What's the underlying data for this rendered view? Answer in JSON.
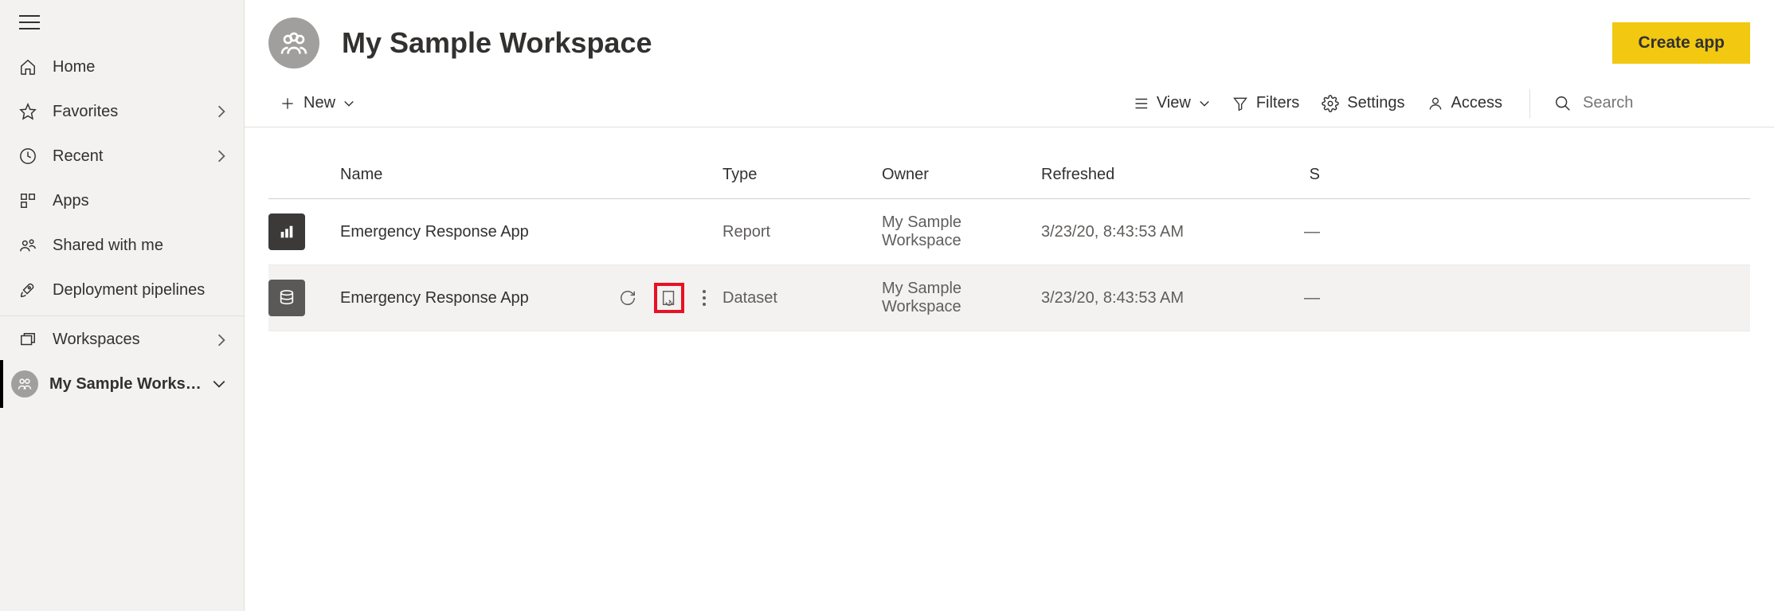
{
  "sidebar": {
    "items": [
      {
        "label": "Home"
      },
      {
        "label": "Favorites",
        "has_chevron": true
      },
      {
        "label": "Recent",
        "has_chevron": true
      },
      {
        "label": "Apps"
      },
      {
        "label": "Shared with me"
      },
      {
        "label": "Deployment pipelines"
      }
    ],
    "workspaces_label": "Workspaces",
    "current_workspace": "My Sample Works…"
  },
  "workspace": {
    "title": "My Sample Workspace",
    "create_app_label": "Create app"
  },
  "toolbar": {
    "new_label": "New",
    "view_label": "View",
    "filters_label": "Filters",
    "settings_label": "Settings",
    "access_label": "Access",
    "search_placeholder": "Search"
  },
  "table": {
    "columns": {
      "name": "Name",
      "type": "Type",
      "owner": "Owner",
      "refreshed": "Refreshed",
      "sensitivity": "S"
    },
    "rows": [
      {
        "icon": "report",
        "name": "Emergency Response App",
        "type": "Report",
        "owner": "My Sample Workspace",
        "refreshed": "3/23/20, 8:43:53 AM",
        "sensitivity": "—",
        "hovered": false
      },
      {
        "icon": "dataset",
        "name": "Emergency Response App",
        "type": "Dataset",
        "owner": "My Sample Workspace",
        "refreshed": "3/23/20, 8:43:53 AM",
        "sensitivity": "—",
        "hovered": true,
        "schedule_highlighted": true
      }
    ]
  }
}
